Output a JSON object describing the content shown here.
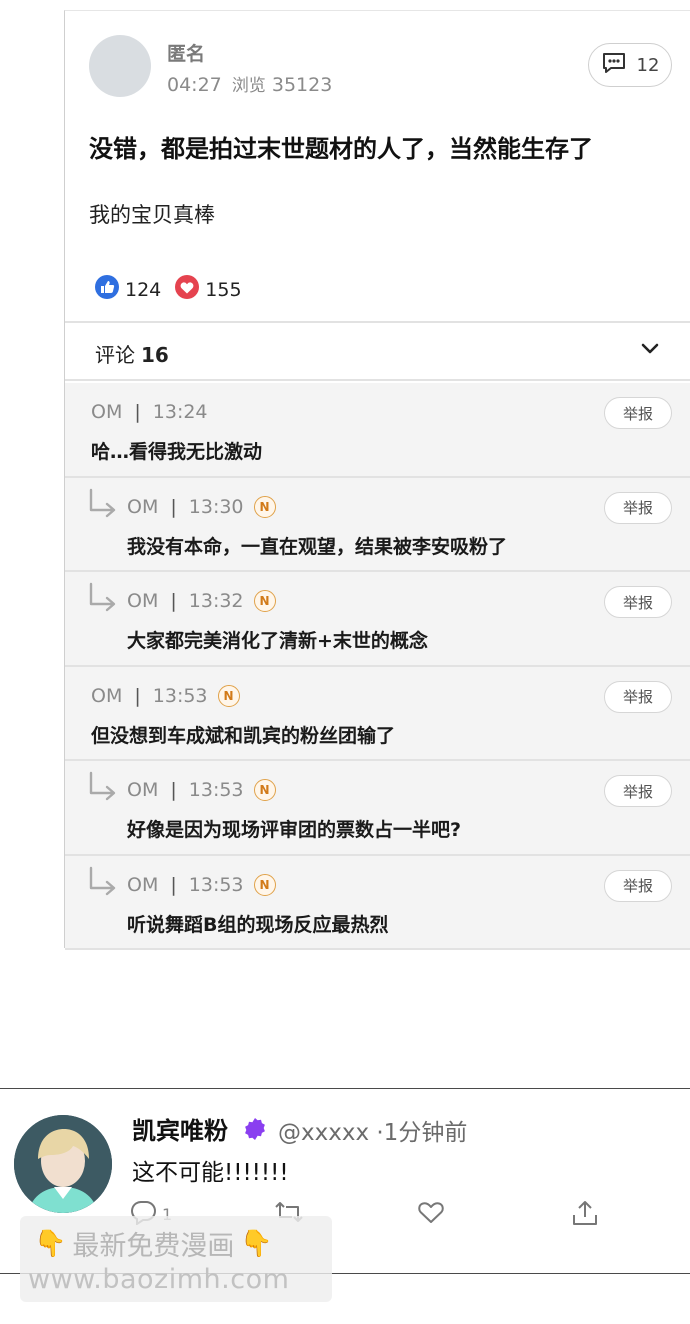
{
  "post": {
    "author": "匿名",
    "time": "04:27",
    "views_label": "浏览",
    "views": "35123",
    "comment_count": "12",
    "title": "没错，都是拍过末世题材的人了，当然能生存了",
    "body": "我的宝贝真棒",
    "likes": "124",
    "hearts": "155"
  },
  "comments_header": {
    "label": "评论",
    "count": "16"
  },
  "comments": [
    {
      "user": "OM",
      "time": "13:24",
      "text": "哈…看得我无比激动",
      "reply": false,
      "badge": "",
      "report": "举报"
    },
    {
      "user": "OM",
      "time": "13:30",
      "text": "我没有本命，一直在观望，结果被李安吸粉了",
      "reply": true,
      "badge": "N",
      "report": "举报"
    },
    {
      "user": "OM",
      "time": "13:32",
      "text": "大家都完美消化了清新+末世的概念",
      "reply": true,
      "badge": "N",
      "report": "举报"
    },
    {
      "user": "OM",
      "time": "13:53",
      "text": "但没想到车成斌和凯宾的粉丝团输了",
      "reply": false,
      "badge": "N",
      "report": "举报"
    },
    {
      "user": "OM",
      "time": "13:53",
      "text": "好像是因为现场评审团的票数占一半吧?",
      "reply": true,
      "badge": "N",
      "report": "举报"
    },
    {
      "user": "OM",
      "time": "13:53",
      "text": "听说舞蹈B组的现场反应最热烈",
      "reply": true,
      "badge": "N",
      "report": "举报"
    }
  ],
  "tweet": {
    "name": "凯宾唯粉",
    "handle": "@xxxxx",
    "time_ago": "·1分钟前",
    "text": "这不可能!!!!!!!",
    "reply_count": "1",
    "retweet_count": ""
  },
  "watermark": {
    "line1": "最新免费漫画",
    "line2": "www.baozimh.com"
  }
}
